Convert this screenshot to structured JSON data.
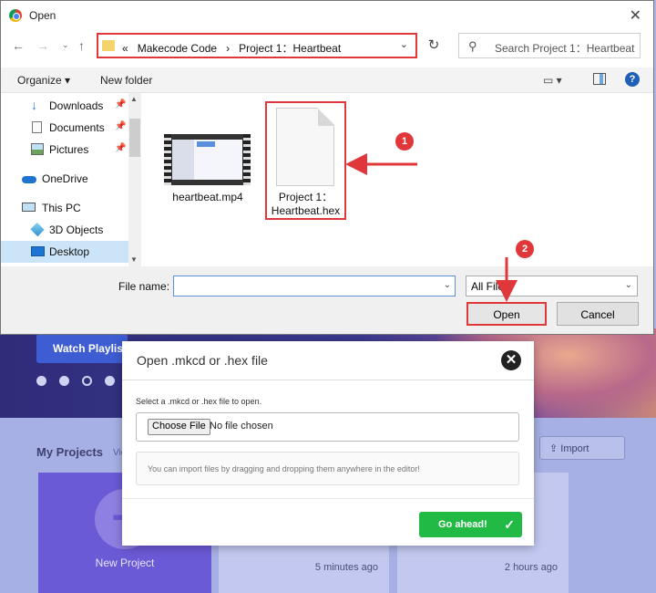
{
  "background_page": {
    "watch_button": "Watch Playlist",
    "section_title": "My Projects",
    "view_all": "View All",
    "import_button": "Import",
    "new_project_label": "New Project",
    "cards": [
      {
        "time": "5 minutes ago"
      },
      {
        "time": "2 hours ago"
      }
    ]
  },
  "import_dialog": {
    "title": "Open .mkcd or .hex file",
    "hint": "Select a .mkcd or .hex file to open.",
    "choose_button": "Choose File",
    "no_file": "No file chosen",
    "drop_hint": "You can import files by dragging and dropping them anywhere in the editor!",
    "go_button": "Go ahead!",
    "go_icon": "✓"
  },
  "open_dialog": {
    "title": "Open",
    "breadcrumb": {
      "overflow": "«",
      "items": [
        "Makecode Code",
        "Project 1：Heartbeat"
      ],
      "separator": "›"
    },
    "search_placeholder": "Search Project 1：Heartbeat",
    "toolbar": {
      "organize": "Organize ▾",
      "new_folder": "New folder"
    },
    "nav_items": [
      {
        "label": "Downloads",
        "icon": "download-icon"
      },
      {
        "label": "Documents",
        "icon": "documents-icon"
      },
      {
        "label": "Pictures",
        "icon": "pictures-icon"
      },
      {
        "label": "OneDrive",
        "icon": "cloud-icon"
      },
      {
        "label": "This PC",
        "icon": "computer-icon"
      },
      {
        "label": "3D Objects",
        "icon": "cube-icon"
      },
      {
        "label": "Desktop",
        "icon": "desktop-icon"
      }
    ],
    "files": [
      {
        "name": "heartbeat.mp4",
        "icon": "video-thumbnail"
      },
      {
        "name_line1": "Project 1：",
        "name_line2": "Heartbeat.hex",
        "icon": "document-icon"
      }
    ],
    "file_name_label": "File name:",
    "file_name_value": "",
    "file_type": "All File",
    "open_button": "Open",
    "cancel_button": "Cancel"
  },
  "annotations": {
    "step1": "1",
    "step2": "2",
    "color": "#e0383a"
  }
}
